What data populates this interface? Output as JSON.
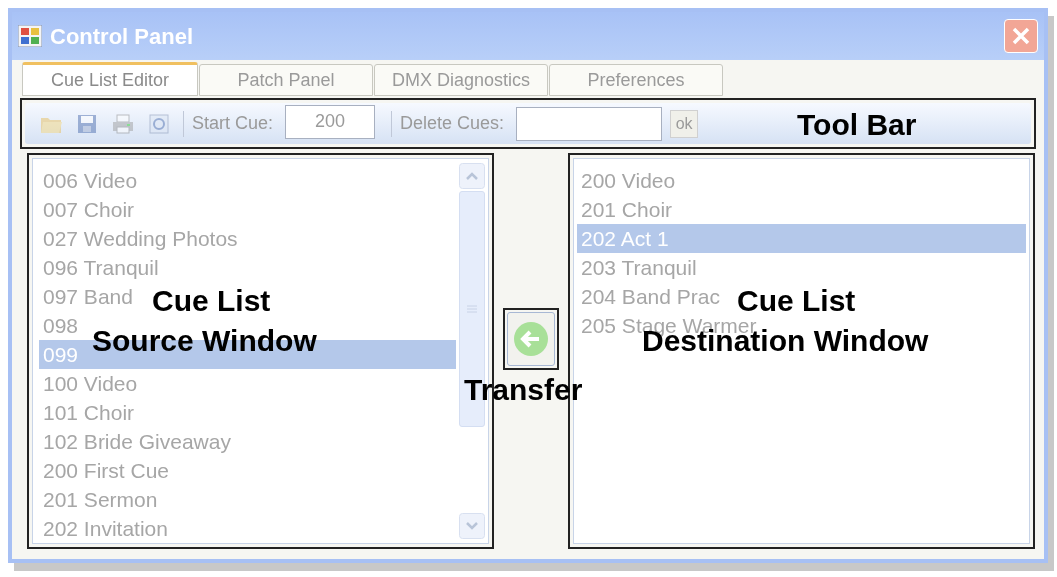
{
  "window": {
    "title": "Control Panel"
  },
  "tabs": [
    {
      "label": "Cue List Editor",
      "selected": true
    },
    {
      "label": "Patch Panel",
      "selected": false
    },
    {
      "label": "DMX Diagnostics",
      "selected": false
    },
    {
      "label": "Preferences",
      "selected": false
    }
  ],
  "toolbar": {
    "start_cue": {
      "label": "Start Cue:",
      "value": "200"
    },
    "delete_cues": {
      "label": "Delete Cues:"
    },
    "ok_button": "ok"
  },
  "source_list": [
    {
      "text": "006 Video",
      "selected": false
    },
    {
      "text": "007 Choir",
      "selected": false
    },
    {
      "text": "027 Wedding Photos",
      "selected": false
    },
    {
      "text": "096 Tranquil",
      "selected": false
    },
    {
      "text": "097 Band",
      "selected": false
    },
    {
      "text": "098",
      "selected": false
    },
    {
      "text": "099",
      "selected": true
    },
    {
      "text": "100 Video",
      "selected": false
    },
    {
      "text": "101 Choir",
      "selected": false
    },
    {
      "text": "102 Bride Giveaway",
      "selected": false
    },
    {
      "text": "200 First Cue",
      "selected": false
    },
    {
      "text": "201 Sermon",
      "selected": false
    },
    {
      "text": "202 Invitation",
      "selected": false
    }
  ],
  "destination_list": [
    {
      "text": "200 Video",
      "selected": false
    },
    {
      "text": "201 Choir",
      "selected": false
    },
    {
      "text": "202 Act 1",
      "selected": true
    },
    {
      "text": "203 Tranquil",
      "selected": false
    },
    {
      "text": "204 Band Prac",
      "selected": false
    },
    {
      "text": "205 Stage Warmer",
      "selected": false
    }
  ],
  "annotations": {
    "tool_bar": "Tool Bar",
    "source": [
      "Cue List",
      "Source Window"
    ],
    "transfer": "Transfer",
    "destination": [
      "Cue List",
      "Destination Window"
    ]
  }
}
